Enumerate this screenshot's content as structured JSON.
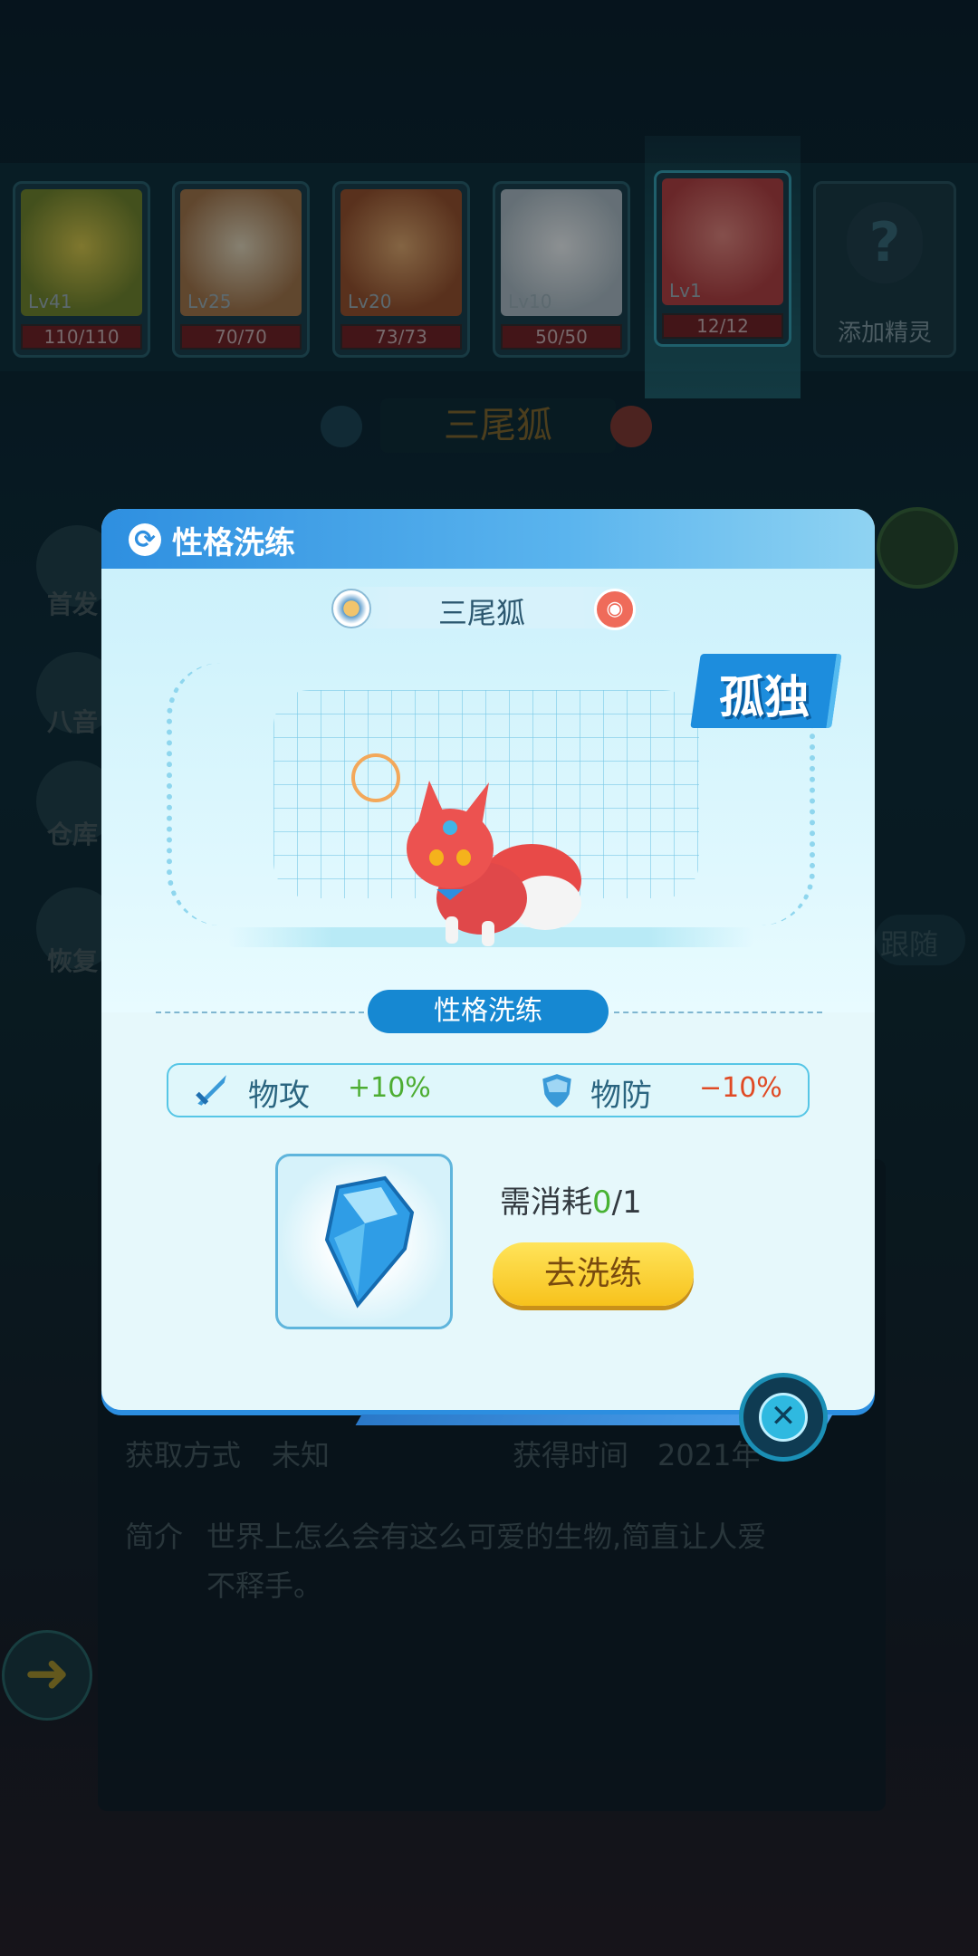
{
  "team": {
    "pets": [
      {
        "level": "Lv41",
        "hp": "110/110",
        "color": "#c8a828"
      },
      {
        "level": "Lv25",
        "hp": "70/70",
        "color": "#d2a66e"
      },
      {
        "level": "Lv20",
        "hp": "73/73",
        "color": "#c87a3a"
      },
      {
        "level": "Lv10",
        "hp": "50/50",
        "color": "#d8dce0"
      },
      {
        "level": "Lv1",
        "hp": "12/12",
        "color": "#e0605a"
      }
    ],
    "add_label": "添加精灵",
    "add_icon": "question-mark-icon"
  },
  "background": {
    "pet_title": "三尾狐",
    "side_menu": [
      "首发",
      "八音",
      "仓库",
      "恢复"
    ],
    "follow_label": "跟随",
    "obtain_label": "获取方式",
    "obtain_value": "未知",
    "obtain_time_label": "获得时间",
    "obtain_time_value": "2021年",
    "intro_label": "简介",
    "intro_text_1": "世界上怎么会有这么可爱的生物,简直让人爱",
    "intro_text_2": "不释手。",
    "back_icon": "back-arrow-icon"
  },
  "modal": {
    "title": "性格洗练",
    "title_icon": "refresh-icon",
    "pet_name": "三尾狐",
    "trait": "孤独",
    "wash_label": "性格洗练",
    "stats": {
      "up_label": "物攻",
      "up_value": "+10%",
      "up_icon": "sword-icon",
      "down_label": "物防",
      "down_value": "−10%",
      "down_icon": "shield-icon"
    },
    "item_icon": "blue-crystal-icon",
    "cost_label": "需消耗",
    "cost_have": "0",
    "cost_need": "/1",
    "go_button": "去洗练",
    "close_icon": "close-icon"
  },
  "colors": {
    "accent": "#1688d2",
    "header": "#2e8fe0",
    "button": "#f7c21c",
    "up": "#4dad32",
    "down": "#e04a24"
  }
}
